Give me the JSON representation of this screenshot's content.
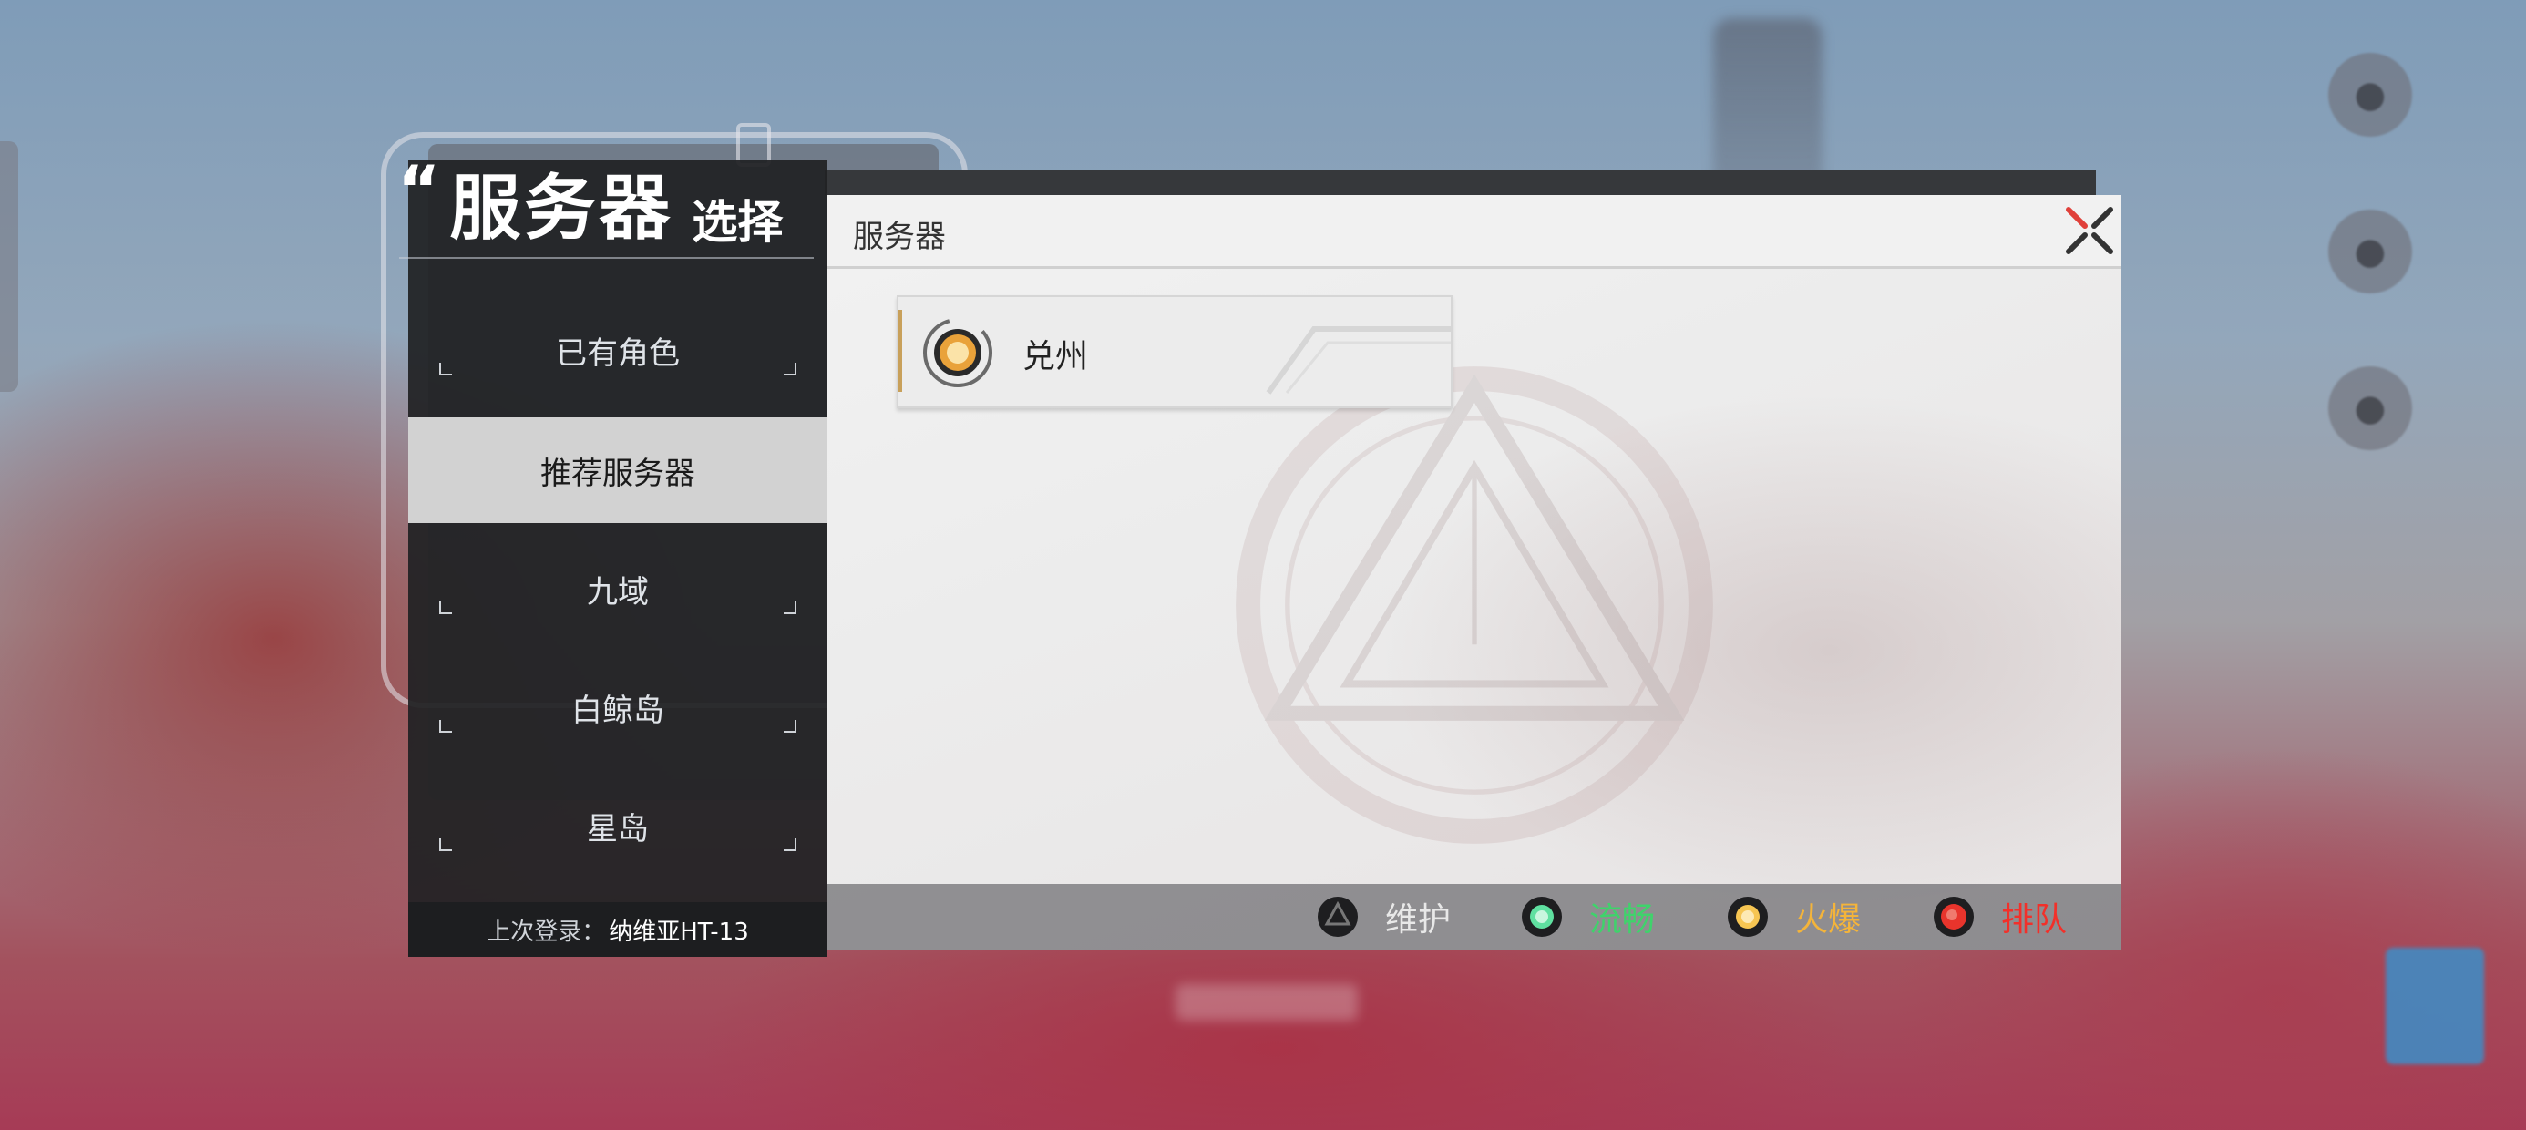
{
  "title": {
    "quote": "“",
    "main": "服务器",
    "sub": "选择"
  },
  "menu": {
    "items": [
      {
        "label": "已有角色"
      },
      {
        "label": "推荐服务器"
      },
      {
        "label": "九域"
      },
      {
        "label": "白鲸岛"
      },
      {
        "label": "星岛"
      }
    ],
    "active_index": 1,
    "last_login_prefix": "上次登录：",
    "last_login_value": "纳维亚HT-13"
  },
  "panel": {
    "title": "服务器",
    "servers": [
      {
        "name": "兑州",
        "status": "火爆"
      }
    ]
  },
  "legend": [
    {
      "label": "维护",
      "color": "#e8e8e8",
      "dot": "#2a2a2c"
    },
    {
      "label": "流畅",
      "color": "#3fd36b",
      "dot": "#5fe0a0"
    },
    {
      "label": "火爆",
      "color": "#f4b43a",
      "dot": "#f6c552"
    },
    {
      "label": "排队",
      "color": "#f2302a",
      "dot": "#e8342c"
    }
  ],
  "colors": {
    "close_red": "#e0403a",
    "close_dark": "#333333",
    "active_bg": "#d2d2d2",
    "menu_bg": "#202123"
  }
}
